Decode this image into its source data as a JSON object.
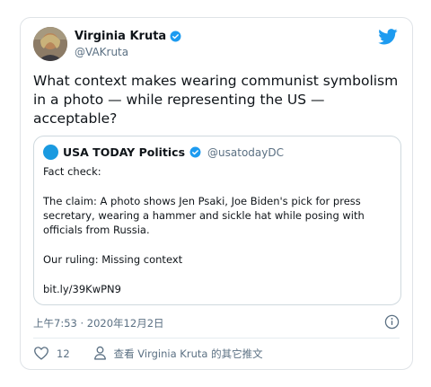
{
  "tweet": {
    "author": {
      "display_name": "Virginia Kruta",
      "handle": "@VAKruta",
      "verified": true
    },
    "text": "What context makes wearing communist symbolism in a photo — while representing the US — acceptable?",
    "timestamp": "上午7:53 · 2020年12月2日",
    "like_count": "12",
    "view_profile_label": "查看 Virginia Kruta 的其它推文"
  },
  "quoted_tweet": {
    "author": {
      "display_name": "USA TODAY Politics",
      "handle": "@usatodayDC",
      "verified": true
    },
    "paragraphs": [
      "Fact check:",
      "The claim: A photo shows Jen Psaki, Joe Biden's pick for press secretary, wearing a hammer and sickle hat while posing with officials from Russia.",
      "Our ruling: Missing context",
      "bit.ly/39KwPN9"
    ]
  },
  "icons": {
    "brand": "twitter-bird-icon",
    "verified": "verified-badge-icon",
    "info": "info-icon",
    "like": "heart-icon",
    "profile": "person-icon"
  },
  "colors": {
    "twitter_blue": "#1d9bf0",
    "text_primary": "#0f1419",
    "text_secondary": "#5b7083",
    "border": "#dfe3e7"
  }
}
